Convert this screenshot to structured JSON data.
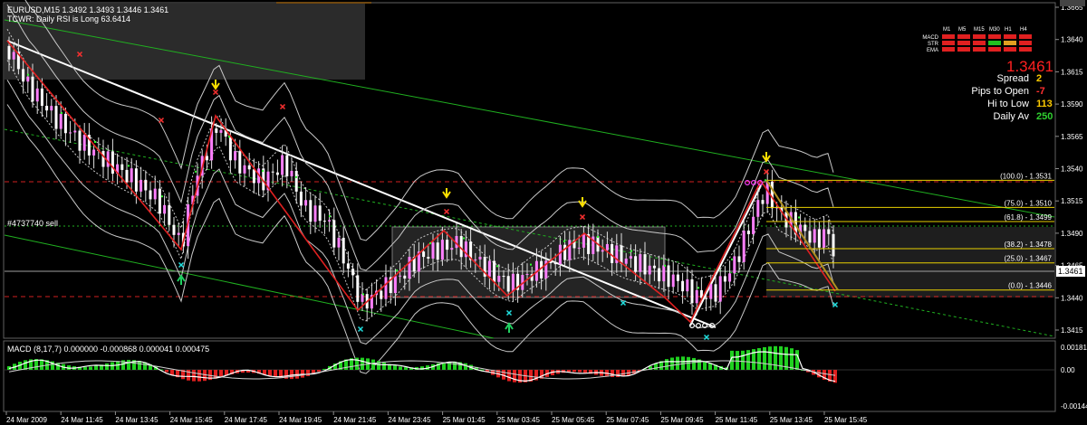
{
  "main_chart": {
    "symbol_header": "EURUSD,M15  1.3492 1.3493 1.3446 1.3461",
    "indicator_note": "TCWR: Daily RSI is Long 63.6414",
    "trade_label": "#4737740 sell",
    "current_price_tag": "1.3461",
    "price_axis": {
      "ticks": [
        "1.3665",
        "1.3640",
        "1.3615",
        "1.3590",
        "1.3565",
        "1.3540",
        "1.3515",
        "1.3490",
        "1.3465",
        "1.3440",
        "1.3415"
      ],
      "values": [
        1.3665,
        1.364,
        1.3615,
        1.359,
        1.3565,
        1.354,
        1.3515,
        1.349,
        1.3465,
        1.344,
        1.3415
      ]
    },
    "fib_levels": [
      {
        "label": "(100.0) - 1.3531",
        "price": 1.3531
      },
      {
        "label": "(75.0) - 1.3510",
        "price": 1.351
      },
      {
        "label": "(61.8) - 1.3499",
        "price": 1.3499
      },
      {
        "label": "(38.2) - 1.3478",
        "price": 1.3478
      },
      {
        "label": "(25.0) - 1.3467",
        "price": 1.3467
      },
      {
        "label": "(0.0) - 1.3446",
        "price": 1.3446
      }
    ]
  },
  "time_axis": [
    "24 Mar 2009",
    "24 Mar 11:45",
    "24 Mar 13:45",
    "24 Mar 15:45",
    "24 Mar 17:45",
    "24 Mar 19:45",
    "24 Mar 21:45",
    "24 Mar 23:45",
    "25 Mar 01:45",
    "25 Mar 03:45",
    "25 Mar 05:45",
    "25 Mar 07:45",
    "25 Mar 09:45",
    "25 Mar 11:45",
    "25 Mar 13:45",
    "25 Mar 15:45"
  ],
  "macd": {
    "header": "MACD (8,17,7) 0.000000 -0.000868 0.000041 0.000475",
    "ticks": [
      "0.00181",
      "0.00",
      "-0.00144"
    ]
  },
  "dashboard": {
    "timeframes": [
      "M1",
      "M5",
      "M15",
      "M30",
      "H1",
      "H4"
    ],
    "rows": [
      {
        "label": "MACD",
        "colors": [
          "#e02020",
          "#e02020",
          "#e02020",
          "#e02020",
          "#e02020",
          "#e02020"
        ]
      },
      {
        "label": "STR",
        "colors": [
          "#e02020",
          "#e02020",
          "#e02020",
          "#20c020",
          "#e0a020",
          "#e02020"
        ]
      },
      {
        "label": "EMA",
        "colors": [
          "#e02020",
          "#e02020",
          "#e02020",
          "#e02020",
          "#e02020",
          "#e02020"
        ]
      }
    ],
    "price": "1.3461",
    "stats": [
      {
        "label": "Spread",
        "value": "2",
        "color": "#ffcc00"
      },
      {
        "label": "Pips to Open",
        "value": "-7",
        "color": "#ff3030"
      },
      {
        "label": "Hi to Low",
        "value": "113",
        "color": "#ffcc00"
      },
      {
        "label": "Daily Av",
        "value": "250",
        "color": "#30d030"
      }
    ]
  },
  "colors": {
    "bull_candle": "#ff7fff",
    "bear_candle": "#ffffff",
    "zigzag": "#e02020",
    "fib": "#e8d000",
    "channel": "#20b020",
    "macd_up": "#20d020",
    "macd_down": "#e02020",
    "signal_arrow_up": "#20d060",
    "signal_arrow_down": "#ffe000"
  }
}
